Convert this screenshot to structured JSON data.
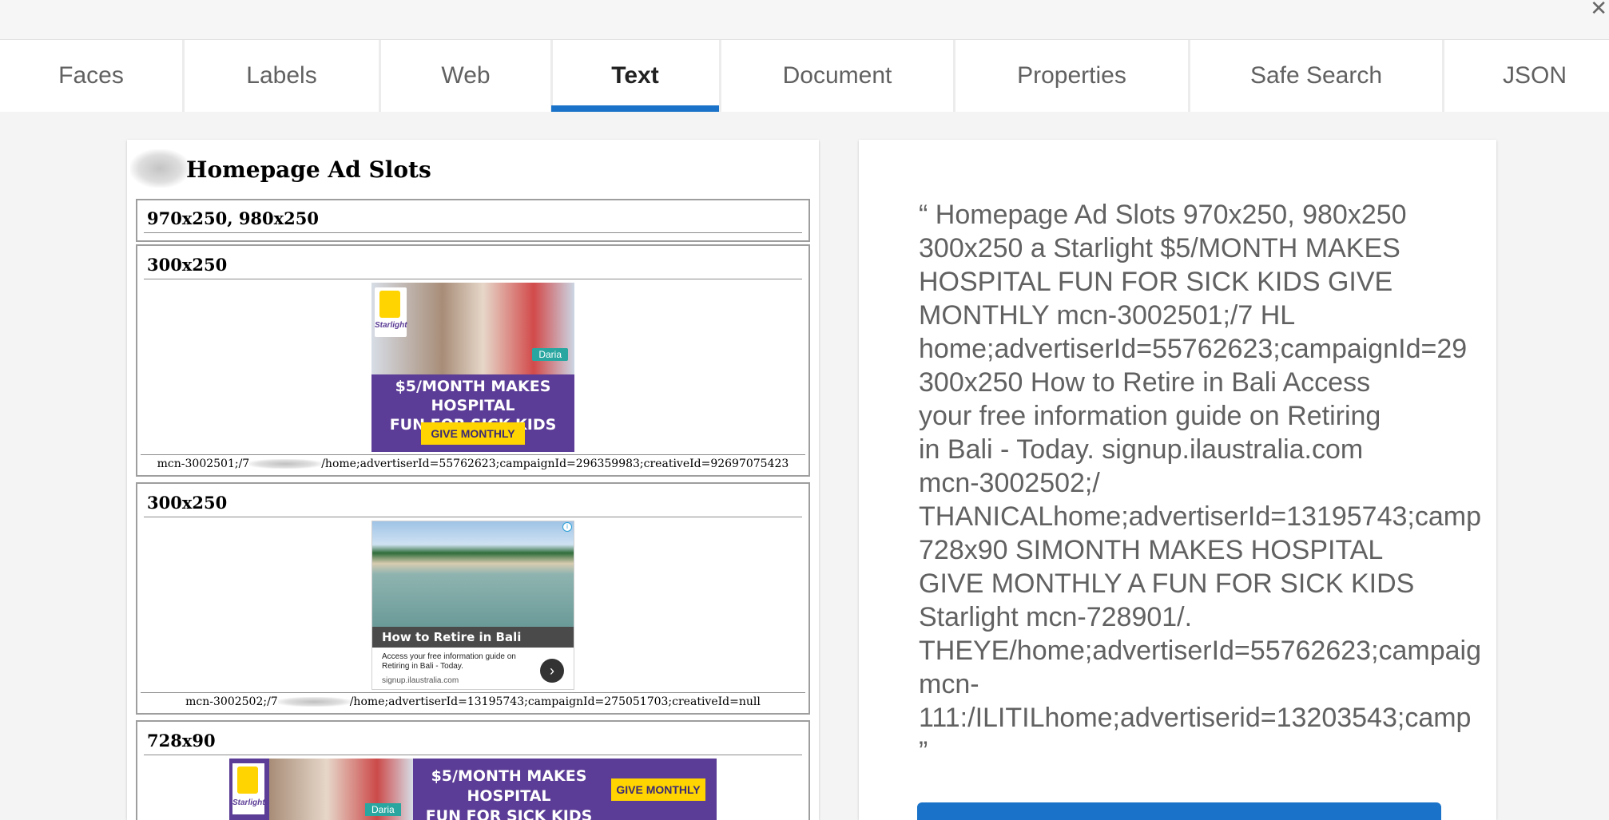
{
  "tabs": [
    {
      "label": "Faces"
    },
    {
      "label": "Labels"
    },
    {
      "label": "Web"
    },
    {
      "label": "Text"
    },
    {
      "label": "Document"
    },
    {
      "label": "Properties"
    },
    {
      "label": "Safe Search"
    },
    {
      "label": "JSON"
    }
  ],
  "active_tab": "Text",
  "window": {
    "close_glyph": "✕"
  },
  "document": {
    "title": "Homepage Ad Slots",
    "slots": [
      {
        "title": "970x250, 980x250"
      },
      {
        "title": "300x250",
        "ad": {
          "logo_text": "Starlight",
          "name_tag": "Daria",
          "headline_line1": "$5/MONTH MAKES HOSPITAL",
          "headline_line2": "FUN FOR SICK KIDS",
          "cta": "GIVE MONTHLY"
        },
        "id_prefix": "mcn-3002501;/7",
        "id_suffix": "/home;advertiserId=55762623;campaignId=296359983;creativeId=92697075423"
      },
      {
        "title": "300x250",
        "ad": {
          "caption": "How to Retire in Bali",
          "body": "Access your free information guide on Retiring in Bali - Today.",
          "domain": "signup.ilaustralia.com",
          "arrow": "›",
          "choice": "i"
        },
        "id_prefix": "mcn-3002502;/7",
        "id_suffix": "/home;advertiserId=13195743;campaignId=275051703;creativeId=null"
      },
      {
        "title": "728x90",
        "ad": {
          "logo_text": "Starlight",
          "name_tag": "Daria",
          "headline_line1": "$5/MONTH MAKES HOSPITAL",
          "headline_line2": "FUN FOR SICK KIDS",
          "cta": "GIVE MONTHLY"
        }
      }
    ]
  },
  "ocr": {
    "open_quote": "“",
    "close_quote": "”",
    "lines": [
      "Homepage Ad Slots 970x250, 980x250",
      "300x250 a Starlight $5/MONTH MAKES",
      "HOSPITAL FUN FOR SICK KIDS GIVE",
      "MONTHLY mcn-3002501;/7 HL",
      "home;advertiserId=55762623;campaignId=29",
      "300x250 How to Retire in Bali Access",
      "your free information guide on Retiring",
      "in Bali - Today. signup.ilaustralia.com",
      "mcn-3002502;/",
      "THANICALhome;advertiserId=13195743;camp",
      "728x90 SIMONTH MAKES HOSPITAL",
      "GIVE MONTHLY A FUN FOR SICK KIDS",
      "Starlight mcn-728901/.",
      "THEYE/home;advertiserId=55762623;campaig",
      "mcn-",
      "111:/ILITILhome;advertiserid=13203543;camp"
    ]
  },
  "colors": {
    "accent": "#1a73c8",
    "ad_purple": "#5b3c96",
    "ad_yellow": "#ffd400"
  }
}
